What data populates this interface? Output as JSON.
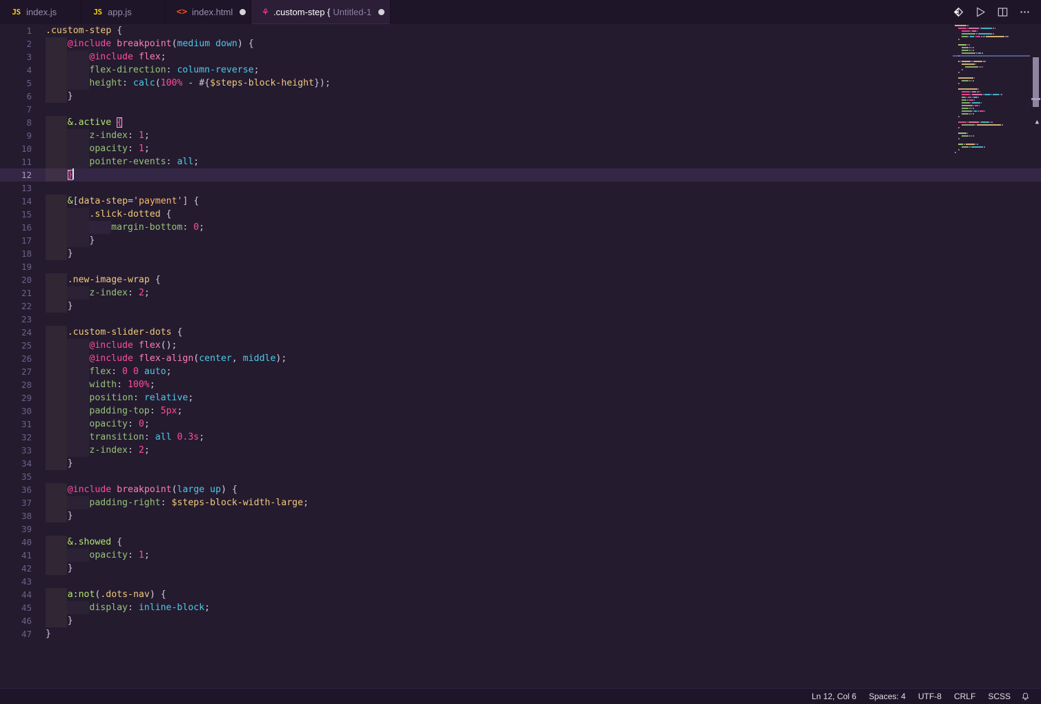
{
  "window": {
    "app": "Visual Studio Code",
    "theme_bg": "#241b2f",
    "accent": "#ff4d9e"
  },
  "tabbar": {
    "tabs": [
      {
        "icon": "js-file-icon",
        "icon_text": "JS",
        "label": "index.js",
        "sublabel": "",
        "dirty": false,
        "active": false
      },
      {
        "icon": "js-file-icon",
        "icon_text": "JS",
        "label": "app.js",
        "sublabel": "",
        "dirty": false,
        "active": false
      },
      {
        "icon": "html-file-icon",
        "icon_text": "<>",
        "label": "index.html",
        "sublabel": "",
        "dirty": true,
        "active": false
      },
      {
        "icon": "sass-file-icon",
        "icon_text": "⚘",
        "label": ".custom-step {",
        "sublabel": "Untitled-1",
        "dirty": true,
        "active": true
      }
    ],
    "actions": [
      {
        "name": "source-control-icon",
        "title": "Source Control"
      },
      {
        "name": "run-play-icon",
        "title": "Run Code"
      },
      {
        "name": "split-editor-icon",
        "title": "Split Editor Right"
      },
      {
        "name": "more-actions-icon",
        "title": "More Actions..."
      }
    ]
  },
  "editor": {
    "language": "SCSS",
    "current_line": 12,
    "lines": [
      {
        "n": 1,
        "indent": 0,
        "tokens": [
          {
            "c": "t-sel",
            "s": ".custom-step"
          },
          {
            "c": "t-pun",
            "s": " {"
          }
        ]
      },
      {
        "n": 2,
        "indent": 1,
        "tokens": [
          {
            "c": "t-at",
            "s": "@include"
          },
          {
            "c": "t-pun",
            "s": " "
          },
          {
            "c": "t-fn",
            "s": "breakpoint"
          },
          {
            "c": "t-paren",
            "s": "("
          },
          {
            "c": "t-kw",
            "s": "medium down"
          },
          {
            "c": "t-paren",
            "s": ")"
          },
          {
            "c": "t-pun",
            "s": " {"
          }
        ]
      },
      {
        "n": 3,
        "indent": 2,
        "tokens": [
          {
            "c": "t-at",
            "s": "@include"
          },
          {
            "c": "t-pun",
            "s": " "
          },
          {
            "c": "t-fn",
            "s": "flex"
          },
          {
            "c": "t-pun",
            "s": ";"
          }
        ]
      },
      {
        "n": 4,
        "indent": 2,
        "tokens": [
          {
            "c": "t-prop",
            "s": "flex-direction"
          },
          {
            "c": "t-pun",
            "s": ": "
          },
          {
            "c": "t-kw",
            "s": "column-reverse"
          },
          {
            "c": "t-pun",
            "s": ";"
          }
        ]
      },
      {
        "n": 5,
        "indent": 2,
        "tokens": [
          {
            "c": "t-prop",
            "s": "height"
          },
          {
            "c": "t-pun",
            "s": ": "
          },
          {
            "c": "t-kw",
            "s": "calc"
          },
          {
            "c": "t-paren",
            "s": "("
          },
          {
            "c": "t-num",
            "s": "100%"
          },
          {
            "c": "t-pun",
            "s": " - "
          },
          {
            "c": "t-pun",
            "s": "#{"
          },
          {
            "c": "t-var",
            "s": "$steps-block-height"
          },
          {
            "c": "t-pun",
            "s": "});"
          }
        ]
      },
      {
        "n": 6,
        "indent": 1,
        "tokens": [
          {
            "c": "t-pun",
            "s": "}"
          }
        ]
      },
      {
        "n": 7,
        "indent": 0,
        "tokens": []
      },
      {
        "n": 8,
        "indent": 1,
        "tokens": [
          {
            "c": "t-amp",
            "s": "&.active"
          },
          {
            "c": "t-pun",
            "s": " "
          },
          {
            "c": "bracket-match",
            "s": "{"
          }
        ]
      },
      {
        "n": 9,
        "indent": 2,
        "tokens": [
          {
            "c": "t-prop",
            "s": "z-index"
          },
          {
            "c": "t-pun",
            "s": ": "
          },
          {
            "c": "t-num",
            "s": "1"
          },
          {
            "c": "t-pun",
            "s": ";"
          }
        ]
      },
      {
        "n": 10,
        "indent": 2,
        "tokens": [
          {
            "c": "t-prop",
            "s": "opacity"
          },
          {
            "c": "t-pun",
            "s": ": "
          },
          {
            "c": "t-num",
            "s": "1"
          },
          {
            "c": "t-pun",
            "s": ";"
          }
        ]
      },
      {
        "n": 11,
        "indent": 2,
        "tokens": [
          {
            "c": "t-prop",
            "s": "pointer-events"
          },
          {
            "c": "t-pun",
            "s": ": "
          },
          {
            "c": "t-kw",
            "s": "all"
          },
          {
            "c": "t-pun",
            "s": ";"
          }
        ]
      },
      {
        "n": 12,
        "indent": 1,
        "current": true,
        "cursor": true,
        "tokens": [
          {
            "c": "bracket-match",
            "s": "}"
          }
        ]
      },
      {
        "n": 13,
        "indent": 0,
        "tokens": []
      },
      {
        "n": 14,
        "indent": 1,
        "tokens": [
          {
            "c": "t-amp",
            "s": "&"
          },
          {
            "c": "t-pun",
            "s": "["
          },
          {
            "c": "t-attr",
            "s": "data-step"
          },
          {
            "c": "t-pun",
            "s": "="
          },
          {
            "c": "t-str",
            "s": "'payment'"
          },
          {
            "c": "t-pun",
            "s": "] {"
          }
        ]
      },
      {
        "n": 15,
        "indent": 2,
        "tokens": [
          {
            "c": "t-sel",
            "s": ".slick-dotted"
          },
          {
            "c": "t-pun",
            "s": " {"
          }
        ]
      },
      {
        "n": 16,
        "indent": 3,
        "tokens": [
          {
            "c": "t-prop",
            "s": "margin-bottom"
          },
          {
            "c": "t-pun",
            "s": ": "
          },
          {
            "c": "t-num",
            "s": "0"
          },
          {
            "c": "t-pun",
            "s": ";"
          }
        ]
      },
      {
        "n": 17,
        "indent": 2,
        "tokens": [
          {
            "c": "t-pun",
            "s": "}"
          }
        ]
      },
      {
        "n": 18,
        "indent": 1,
        "tokens": [
          {
            "c": "t-pun",
            "s": "}"
          }
        ]
      },
      {
        "n": 19,
        "indent": 0,
        "tokens": []
      },
      {
        "n": 20,
        "indent": 1,
        "tokens": [
          {
            "c": "t-sel",
            "s": ".new-image-wrap"
          },
          {
            "c": "t-pun",
            "s": " {"
          }
        ]
      },
      {
        "n": 21,
        "indent": 2,
        "tokens": [
          {
            "c": "t-prop",
            "s": "z-index"
          },
          {
            "c": "t-pun",
            "s": ": "
          },
          {
            "c": "t-num",
            "s": "2"
          },
          {
            "c": "t-pun",
            "s": ";"
          }
        ]
      },
      {
        "n": 22,
        "indent": 1,
        "tokens": [
          {
            "c": "t-pun",
            "s": "}"
          }
        ]
      },
      {
        "n": 23,
        "indent": 0,
        "tokens": []
      },
      {
        "n": 24,
        "indent": 1,
        "tokens": [
          {
            "c": "t-sel",
            "s": ".custom-slider-dots"
          },
          {
            "c": "t-pun",
            "s": " {"
          }
        ]
      },
      {
        "n": 25,
        "indent": 2,
        "tokens": [
          {
            "c": "t-at",
            "s": "@include"
          },
          {
            "c": "t-pun",
            "s": " "
          },
          {
            "c": "t-fn",
            "s": "flex"
          },
          {
            "c": "t-paren",
            "s": "()"
          },
          {
            "c": "t-pun",
            "s": ";"
          }
        ]
      },
      {
        "n": 26,
        "indent": 2,
        "tokens": [
          {
            "c": "t-at",
            "s": "@include"
          },
          {
            "c": "t-pun",
            "s": " "
          },
          {
            "c": "t-fn",
            "s": "flex-align"
          },
          {
            "c": "t-paren",
            "s": "("
          },
          {
            "c": "t-kw",
            "s": "center"
          },
          {
            "c": "t-pun",
            "s": ", "
          },
          {
            "c": "t-kw",
            "s": "middle"
          },
          {
            "c": "t-paren",
            "s": ")"
          },
          {
            "c": "t-pun",
            "s": ";"
          }
        ]
      },
      {
        "n": 27,
        "indent": 2,
        "tokens": [
          {
            "c": "t-prop",
            "s": "flex"
          },
          {
            "c": "t-pun",
            "s": ": "
          },
          {
            "c": "t-num",
            "s": "0 0"
          },
          {
            "c": "t-pun",
            "s": " "
          },
          {
            "c": "t-kw",
            "s": "auto"
          },
          {
            "c": "t-pun",
            "s": ";"
          }
        ]
      },
      {
        "n": 28,
        "indent": 2,
        "tokens": [
          {
            "c": "t-prop",
            "s": "width"
          },
          {
            "c": "t-pun",
            "s": ": "
          },
          {
            "c": "t-num",
            "s": "100%"
          },
          {
            "c": "t-pun",
            "s": ";"
          }
        ]
      },
      {
        "n": 29,
        "indent": 2,
        "tokens": [
          {
            "c": "t-prop",
            "s": "position"
          },
          {
            "c": "t-pun",
            "s": ": "
          },
          {
            "c": "t-kw",
            "s": "relative"
          },
          {
            "c": "t-pun",
            "s": ";"
          }
        ]
      },
      {
        "n": 30,
        "indent": 2,
        "tokens": [
          {
            "c": "t-prop",
            "s": "padding-top"
          },
          {
            "c": "t-pun",
            "s": ": "
          },
          {
            "c": "t-num",
            "s": "5px"
          },
          {
            "c": "t-pun",
            "s": ";"
          }
        ]
      },
      {
        "n": 31,
        "indent": 2,
        "tokens": [
          {
            "c": "t-prop",
            "s": "opacity"
          },
          {
            "c": "t-pun",
            "s": ": "
          },
          {
            "c": "t-num",
            "s": "0"
          },
          {
            "c": "t-pun",
            "s": ";"
          }
        ]
      },
      {
        "n": 32,
        "indent": 2,
        "tokens": [
          {
            "c": "t-prop",
            "s": "transition"
          },
          {
            "c": "t-pun",
            "s": ": "
          },
          {
            "c": "t-kw",
            "s": "all"
          },
          {
            "c": "t-pun",
            "s": " "
          },
          {
            "c": "t-num",
            "s": "0.3s"
          },
          {
            "c": "t-pun",
            "s": ";"
          }
        ]
      },
      {
        "n": 33,
        "indent": 2,
        "tokens": [
          {
            "c": "t-prop",
            "s": "z-index"
          },
          {
            "c": "t-pun",
            "s": ": "
          },
          {
            "c": "t-num",
            "s": "2"
          },
          {
            "c": "t-pun",
            "s": ";"
          }
        ]
      },
      {
        "n": 34,
        "indent": 1,
        "tokens": [
          {
            "c": "t-pun",
            "s": "}"
          }
        ]
      },
      {
        "n": 35,
        "indent": 0,
        "tokens": []
      },
      {
        "n": 36,
        "indent": 1,
        "tokens": [
          {
            "c": "t-at",
            "s": "@include"
          },
          {
            "c": "t-pun",
            "s": " "
          },
          {
            "c": "t-fn",
            "s": "breakpoint"
          },
          {
            "c": "t-paren",
            "s": "("
          },
          {
            "c": "t-kw",
            "s": "large up"
          },
          {
            "c": "t-paren",
            "s": ")"
          },
          {
            "c": "t-pun",
            "s": " {"
          }
        ]
      },
      {
        "n": 37,
        "indent": 2,
        "tokens": [
          {
            "c": "t-prop",
            "s": "padding-right"
          },
          {
            "c": "t-pun",
            "s": ": "
          },
          {
            "c": "t-var",
            "s": "$steps-block-width-large"
          },
          {
            "c": "t-pun",
            "s": ";"
          }
        ]
      },
      {
        "n": 38,
        "indent": 1,
        "tokens": [
          {
            "c": "t-pun",
            "s": "}"
          }
        ]
      },
      {
        "n": 39,
        "indent": 0,
        "tokens": []
      },
      {
        "n": 40,
        "indent": 1,
        "tokens": [
          {
            "c": "t-amp",
            "s": "&.showed"
          },
          {
            "c": "t-pun",
            "s": " {"
          }
        ]
      },
      {
        "n": 41,
        "indent": 2,
        "tokens": [
          {
            "c": "t-prop",
            "s": "opacity"
          },
          {
            "c": "t-pun",
            "s": ": "
          },
          {
            "c": "t-num",
            "s": "1"
          },
          {
            "c": "t-pun",
            "s": ";"
          }
        ]
      },
      {
        "n": 42,
        "indent": 1,
        "tokens": [
          {
            "c": "t-pun",
            "s": "}"
          }
        ]
      },
      {
        "n": 43,
        "indent": 0,
        "tokens": []
      },
      {
        "n": 44,
        "indent": 1,
        "tokens": [
          {
            "c": "t-amp",
            "s": "a:not"
          },
          {
            "c": "t-paren",
            "s": "("
          },
          {
            "c": "t-sel",
            "s": ".dots-nav"
          },
          {
            "c": "t-paren",
            "s": ")"
          },
          {
            "c": "t-pun",
            "s": " {"
          }
        ]
      },
      {
        "n": 45,
        "indent": 2,
        "tokens": [
          {
            "c": "t-prop",
            "s": "display"
          },
          {
            "c": "t-pun",
            "s": ": "
          },
          {
            "c": "t-kw",
            "s": "inline-block"
          },
          {
            "c": "t-pun",
            "s": ";"
          }
        ]
      },
      {
        "n": 46,
        "indent": 1,
        "tokens": [
          {
            "c": "t-pun",
            "s": "}"
          }
        ]
      },
      {
        "n": 47,
        "indent": 0,
        "tokens": [
          {
            "c": "t-pun",
            "s": "}"
          }
        ]
      }
    ]
  },
  "statusbar": {
    "items": [
      {
        "name": "cursor-position",
        "label": "Ln 12, Col 6"
      },
      {
        "name": "indentation",
        "label": "Spaces: 4"
      },
      {
        "name": "encoding",
        "label": "UTF-8"
      },
      {
        "name": "line-endings",
        "label": "CRLF"
      },
      {
        "name": "language-mode",
        "label": "SCSS"
      }
    ],
    "bell": "🔔"
  }
}
